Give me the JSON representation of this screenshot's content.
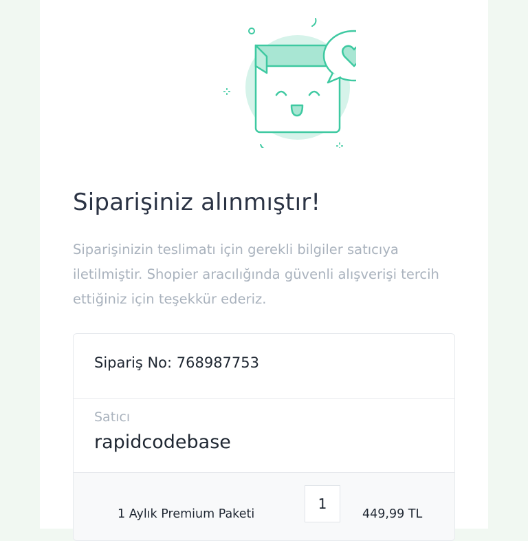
{
  "confirmation": {
    "title": "Siparişiniz alınmıştır!",
    "description": "Siparişinizin teslimatı için gerekli bilgiler satıcıya iletilmiştir. Shopier aracılığında güvenli alışverişi tercih ettiğiniz için teşekkür ederiz."
  },
  "order": {
    "number_text": "Sipariş No: 768987753",
    "seller_label": "Satıcı",
    "seller_name": "rapidcodebase"
  },
  "items": [
    {
      "name": "1 Aylık Premium Paketi",
      "quantity": "1",
      "price": "449,99 TL"
    }
  ],
  "colors": {
    "accent": "#3ec9a1",
    "accent_light": "#d6f3ea",
    "title": "#2b3344",
    "muted": "#a9b2bd",
    "outside": "#f1f8f2"
  },
  "icons": [
    "happy-box-illustration",
    "heart-icon",
    "speech-bubble-icon"
  ]
}
